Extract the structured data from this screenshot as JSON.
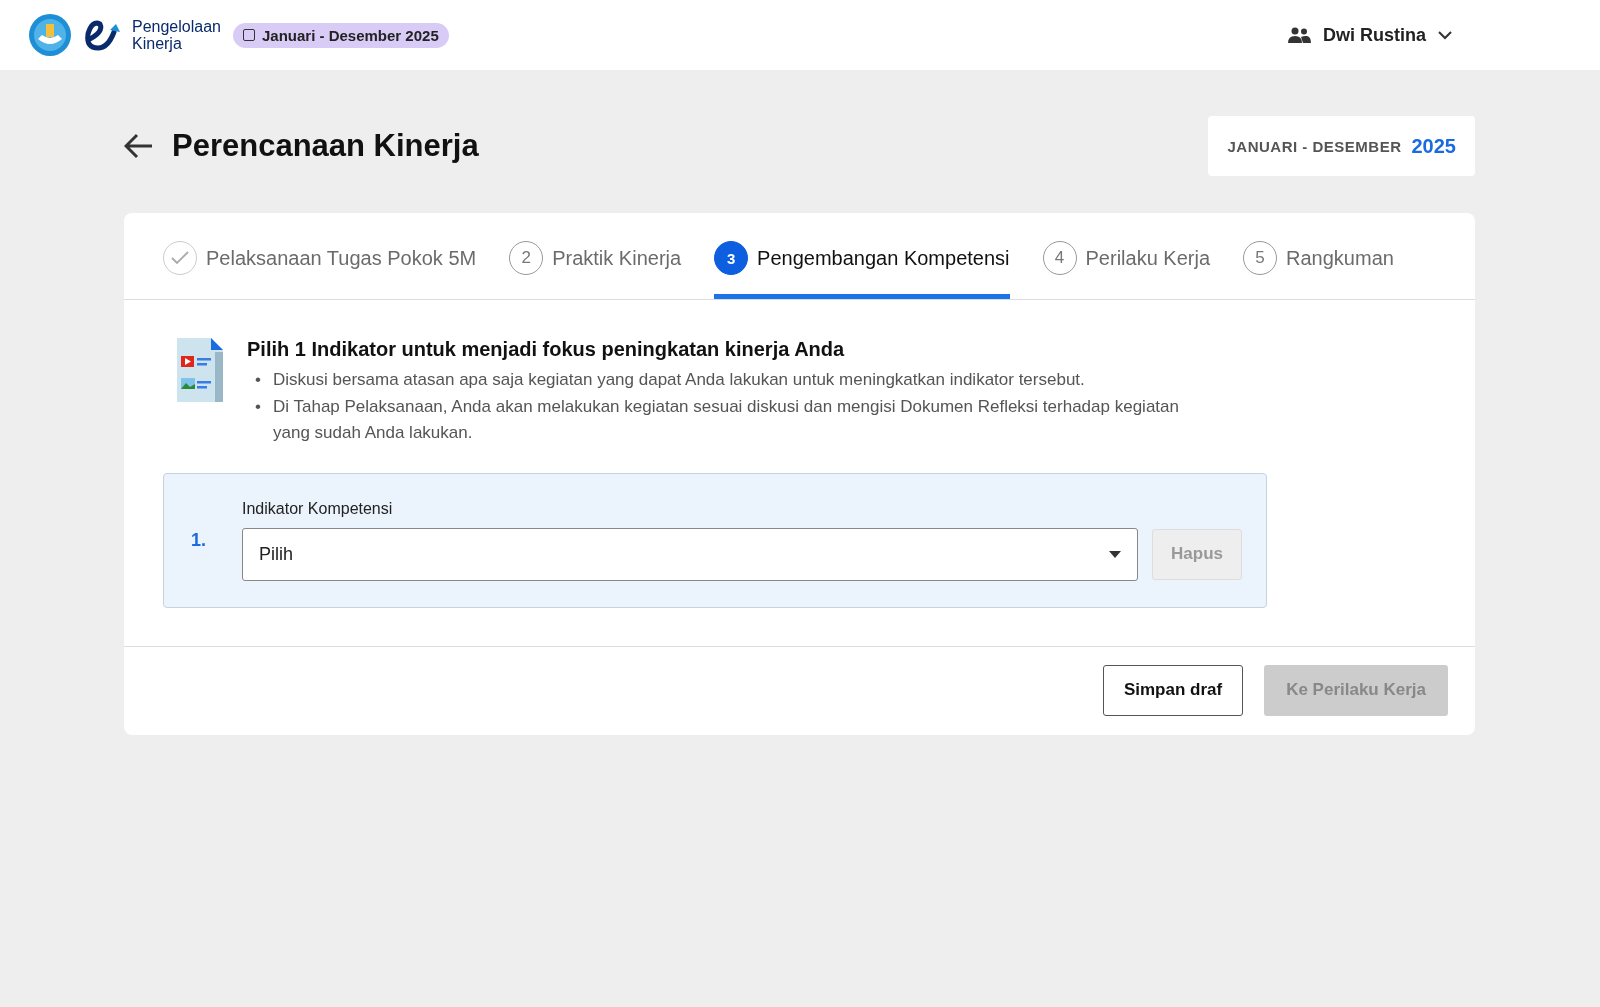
{
  "header": {
    "app_name": "Pengelolaan",
    "app_name_2": "Kinerja",
    "period_badge": "Januari - Desember 2025",
    "user": "Dwi Rustina"
  },
  "page": {
    "title": "Perencanaan Kinerja",
    "period_label": "JANUARI - DESEMBER",
    "period_year": "2025"
  },
  "steps": [
    {
      "label": "Pelaksanaan Tugas Pokok 5M",
      "completed": true,
      "selected": false
    },
    {
      "number": "2",
      "label": "Praktik Kinerja",
      "completed": false,
      "selected": false
    },
    {
      "number": "3",
      "label": "Pengembangan Kompetensi",
      "completed": false,
      "selected": true
    },
    {
      "number": "4",
      "label": "Perilaku Kerja",
      "completed": false,
      "selected": false
    },
    {
      "number": "5",
      "label": "Rangkuman",
      "completed": false,
      "selected": false
    }
  ],
  "intro": {
    "heading": "Pilih 1 Indikator untuk menjadi fokus peningkatan kinerja Anda",
    "bullets": [
      {
        "marker": "•",
        "text": "Diskusi bersama atasan apa saja kegiatan yang dapat Anda lakukan untuk meningkatkan indikator tersebut."
      },
      {
        "marker": "•",
        "text": "Di Tahap Pelaksanaan, Anda akan melakukan kegiatan sesuai diskusi dan mengisi Dokumen Refleksi terhadap kegiatan yang sudah Anda lakukan."
      }
    ]
  },
  "indicators": [
    {
      "number": "1.",
      "label": "Indikator Kompetensi",
      "value": "Pilih",
      "delete_button": "Hapus",
      "delete_disabled": true
    }
  ],
  "footer": {
    "draft_button": "Simpan draf",
    "next_button": "Ke Perilaku Kerja",
    "next_disabled": true
  }
}
